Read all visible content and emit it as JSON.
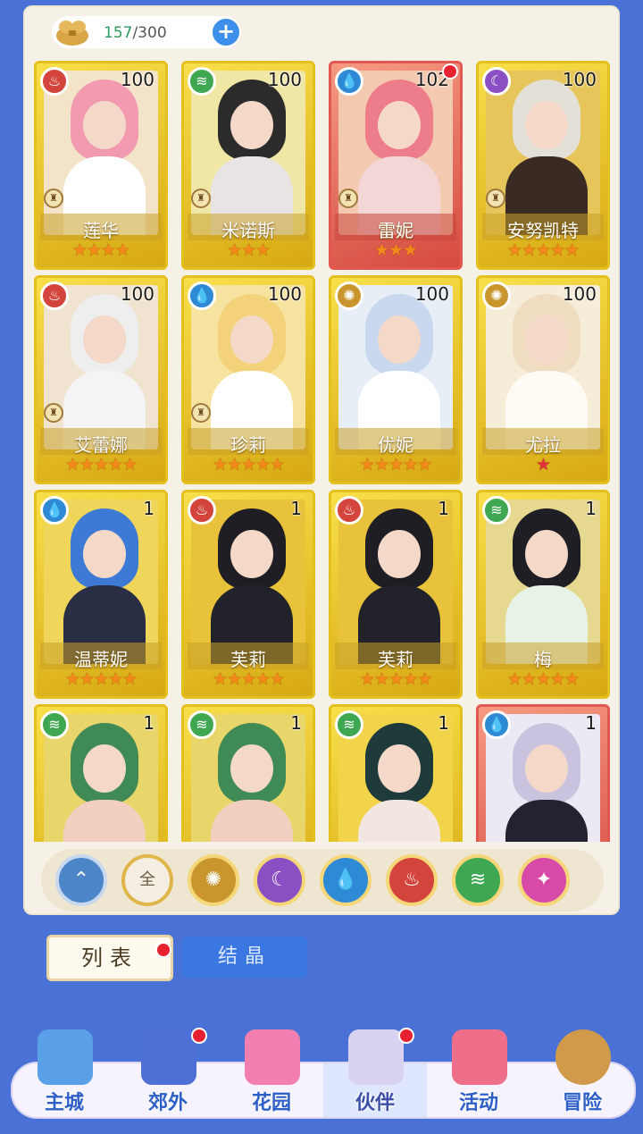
{
  "capacity": {
    "current": "157",
    "max": "/300",
    "add_icon": "plus-icon"
  },
  "cards": [
    {
      "name": "莲华",
      "level": "100",
      "element": "fire",
      "stars": "★★★★",
      "frame": "gold",
      "badge": true
    },
    {
      "name": "米诺斯",
      "level": "100",
      "element": "wind",
      "stars": "★★★",
      "frame": "gold",
      "badge": true
    },
    {
      "name": "雷妮",
      "level": "102",
      "element": "water",
      "stars": "★★★",
      "frame": "red",
      "badge": true,
      "dot": true
    },
    {
      "name": "安努凯特",
      "level": "100",
      "element": "moon",
      "stars": "★★★★★",
      "frame": "gold",
      "badge": true
    },
    {
      "name": "艾蕾娜",
      "level": "100",
      "element": "fire",
      "stars": "★★★★★",
      "frame": "gold",
      "badge": true
    },
    {
      "name": "珍莉",
      "level": "100",
      "element": "water",
      "stars": "★★★★★",
      "frame": "gold",
      "badge": true
    },
    {
      "name": "优妮",
      "level": "100",
      "element": "sun",
      "stars": "★★★★★",
      "frame": "gold",
      "badge": false
    },
    {
      "name": "尤拉",
      "level": "100",
      "element": "sun",
      "stars": "★",
      "frame": "gold",
      "badge": false
    },
    {
      "name": "温蒂妮",
      "level": "1",
      "element": "water",
      "stars": "★★★★★",
      "frame": "gold",
      "badge": false
    },
    {
      "name": "芙莉",
      "level": "1",
      "element": "fire",
      "stars": "★★★★★",
      "frame": "gold",
      "badge": false
    },
    {
      "name": "芙莉",
      "level": "1",
      "element": "fire",
      "stars": "★★★★★",
      "frame": "gold",
      "badge": false
    },
    {
      "name": "梅",
      "level": "1",
      "element": "wind",
      "stars": "★★★★★",
      "frame": "gold",
      "badge": false
    },
    {
      "name": "",
      "level": "1",
      "element": "wind",
      "stars": "",
      "frame": "gold",
      "badge": false
    },
    {
      "name": "",
      "level": "1",
      "element": "wind",
      "stars": "",
      "frame": "gold",
      "badge": false
    },
    {
      "name": "",
      "level": "1",
      "element": "wind",
      "stars": "",
      "frame": "gold",
      "badge": false
    },
    {
      "name": "",
      "level": "1",
      "element": "water",
      "stars": "",
      "frame": "red",
      "badge": false
    }
  ],
  "filters": [
    {
      "key": "top",
      "icon": "wing-icon",
      "glyph": "⌃"
    },
    {
      "key": "all",
      "label": "全",
      "icon": "all-icon"
    },
    {
      "key": "sun",
      "icon": "sun-icon",
      "glyph": "✺"
    },
    {
      "key": "moon",
      "icon": "moon-icon",
      "glyph": "☾"
    },
    {
      "key": "water",
      "icon": "water-drop-icon",
      "glyph": "💧"
    },
    {
      "key": "fire",
      "icon": "fire-icon",
      "glyph": "♨"
    },
    {
      "key": "wind",
      "icon": "wind-icon",
      "glyph": "≋"
    },
    {
      "key": "star",
      "icon": "orbit-icon",
      "glyph": "✦"
    }
  ],
  "tabs": {
    "list": "列表",
    "crystal": "结晶"
  },
  "nav": [
    {
      "label": "主城",
      "icon": "castle-icon"
    },
    {
      "label": "郊外",
      "icon": "magic-circle-icon",
      "dot": true
    },
    {
      "label": "花园",
      "icon": "heart-icon"
    },
    {
      "label": "伙伴",
      "icon": "companion-icon",
      "dot": true,
      "active": true
    },
    {
      "label": "活动",
      "icon": "gift-icon"
    },
    {
      "label": "冒险",
      "icon": "compass-icon"
    }
  ],
  "colors": {
    "gold_frame": "#e4c01d",
    "red_frame": "#e0584f",
    "accent_blue": "#3d8fe9",
    "bg_blue": "#4a72d6"
  }
}
